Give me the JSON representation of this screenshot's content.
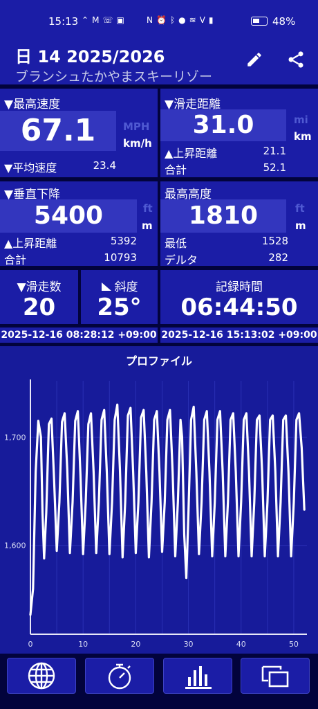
{
  "status_bar": {
    "time": "15:13",
    "left_icons": [
      "signal-swoosh-icon",
      "gmail-icon",
      "wifi-calling-icon",
      "wallet-icon"
    ],
    "right_icons": [
      "nfc-icon",
      "alarm-icon",
      "bluetooth-icon",
      "location-icon",
      "wifi-icon",
      "volte-icon",
      "cell-signal-icon"
    ],
    "battery": "48%",
    "battery_level": 0.48
  },
  "header": {
    "title": "日 14 2025/2026",
    "subtitle": "ブランシュたかやまスキーリゾー",
    "edit_icon": "pencil-icon",
    "share_icon": "share-icon"
  },
  "max_speed": {
    "label": "▼最高速度",
    "value": "67.1",
    "unit_inactive": "MPH",
    "unit_active": "km/h",
    "avg_label": "▼平均速度",
    "avg_value": "23.4"
  },
  "ski_distance": {
    "label": "▼滑走距離",
    "value": "31.0",
    "unit_inactive": "mi",
    "unit_active": "km",
    "ascent_label": "▲上昇距離",
    "ascent_value": "21.1",
    "total_label": "合計",
    "total_value": "52.1"
  },
  "vertical_descent": {
    "label": "▼垂直下降",
    "value": "5400",
    "unit_inactive": "ft",
    "unit_active": "m",
    "ascent_label": "▲上昇距離",
    "ascent_value": "5392",
    "total_label": "合計",
    "total_value": "10793"
  },
  "max_altitude": {
    "label": "最高高度",
    "value": "1810",
    "unit_inactive": "ft",
    "unit_active": "m",
    "min_label": "最低",
    "min_value": "1528",
    "delta_label": "デルタ",
    "delta_value": "282"
  },
  "runs": {
    "label": "▼滑走数",
    "value": "20"
  },
  "slope": {
    "label": "斜度",
    "value": "25°"
  },
  "recording_time": {
    "label": "記録時間",
    "value": "06:44:50"
  },
  "start_time": "2025-12-16 08:28:12 +09:00",
  "end_time": "2025-12-16 15:13:02 +09:00",
  "chart_data": {
    "type": "line",
    "title": "プロファイル",
    "xlabel": "",
    "ylabel": "",
    "x_ticks": [
      0,
      10,
      20,
      30,
      40,
      50
    ],
    "y_ticks": [
      1600,
      1700
    ],
    "y_tick_labels": [
      "1,600",
      "1,700"
    ],
    "xlim": [
      0,
      52.5
    ],
    "ylim": [
      1518,
      1752
    ],
    "grid": true,
    "series": [
      {
        "values": [
          [
            0,
            1536
          ],
          [
            0.5,
            1560
          ],
          [
            1,
            1668
          ],
          [
            1.5,
            1715
          ],
          [
            2,
            1700
          ],
          [
            2.3,
            1630
          ],
          [
            2.6,
            1588
          ],
          [
            3,
            1630
          ],
          [
            3.5,
            1712
          ],
          [
            4,
            1717
          ],
          [
            4.5,
            1660
          ],
          [
            5,
            1595
          ],
          [
            5.5,
            1640
          ],
          [
            6,
            1714
          ],
          [
            6.5,
            1722
          ],
          [
            7,
            1670
          ],
          [
            7.5,
            1593
          ],
          [
            8,
            1640
          ],
          [
            8.5,
            1715
          ],
          [
            9,
            1724
          ],
          [
            9.5,
            1665
          ],
          [
            10,
            1592
          ],
          [
            10.5,
            1640
          ],
          [
            11,
            1712
          ],
          [
            11.5,
            1722
          ],
          [
            12,
            1668
          ],
          [
            12.5,
            1593
          ],
          [
            13,
            1640
          ],
          [
            13.5,
            1716
          ],
          [
            14,
            1725
          ],
          [
            14.5,
            1668
          ],
          [
            15,
            1592
          ],
          [
            15.5,
            1640
          ],
          [
            16,
            1716
          ],
          [
            16.5,
            1730
          ],
          [
            17,
            1670
          ],
          [
            17.5,
            1589
          ],
          [
            18,
            1640
          ],
          [
            18.5,
            1720
          ],
          [
            19,
            1727
          ],
          [
            19.5,
            1668
          ],
          [
            20,
            1593
          ],
          [
            20.5,
            1640
          ],
          [
            21,
            1718
          ],
          [
            21.5,
            1725
          ],
          [
            22,
            1668
          ],
          [
            22.5,
            1589
          ],
          [
            23,
            1640
          ],
          [
            23.5,
            1716
          ],
          [
            24,
            1724
          ],
          [
            24.5,
            1668
          ],
          [
            25,
            1594
          ],
          [
            25.5,
            1640
          ],
          [
            26,
            1716
          ],
          [
            26.5,
            1725
          ],
          [
            27,
            1668
          ],
          [
            27.5,
            1590
          ],
          [
            28,
            1640
          ],
          [
            28.5,
            1716
          ],
          [
            28.8,
            1700
          ],
          [
            29.2,
            1610
          ],
          [
            29.6,
            1570
          ],
          [
            30,
            1630
          ],
          [
            30.5,
            1716
          ],
          [
            31,
            1728
          ],
          [
            31.5,
            1668
          ],
          [
            32,
            1592
          ],
          [
            32.5,
            1640
          ],
          [
            33,
            1716
          ],
          [
            33.5,
            1724
          ],
          [
            34,
            1668
          ],
          [
            34.5,
            1590
          ],
          [
            35,
            1640
          ],
          [
            35.5,
            1716
          ],
          [
            36,
            1724
          ],
          [
            36.5,
            1668
          ],
          [
            37,
            1590
          ],
          [
            37.5,
            1640
          ],
          [
            38,
            1716
          ],
          [
            38.5,
            1722
          ],
          [
            39,
            1668
          ],
          [
            39.5,
            1590
          ],
          [
            40,
            1640
          ],
          [
            40.5,
            1716
          ],
          [
            41,
            1722
          ],
          [
            41.5,
            1668
          ],
          [
            42,
            1590
          ],
          [
            42.5,
            1640
          ],
          [
            43,
            1716
          ],
          [
            43.5,
            1720
          ],
          [
            44,
            1668
          ],
          [
            44.5,
            1590
          ],
          [
            45,
            1640
          ],
          [
            45.5,
            1716
          ],
          [
            46,
            1720
          ],
          [
            46.5,
            1668
          ],
          [
            47,
            1590
          ],
          [
            47.5,
            1640
          ],
          [
            48,
            1716
          ],
          [
            48.5,
            1720
          ],
          [
            49,
            1668
          ],
          [
            49.5,
            1590
          ],
          [
            50,
            1640
          ],
          [
            50.5,
            1716
          ],
          [
            51,
            1722
          ],
          [
            51.5,
            1690
          ],
          [
            52,
            1633
          ]
        ]
      }
    ]
  },
  "nav": {
    "items": [
      "globe-icon",
      "stopwatch-icon",
      "bar-chart-icon",
      "slides-icon"
    ]
  },
  "colors": {
    "panel": "#1b1da6",
    "value_box": "#3336be",
    "background": "#02033c",
    "inactive_unit": "#4f59d2",
    "line": "#ffffff"
  }
}
